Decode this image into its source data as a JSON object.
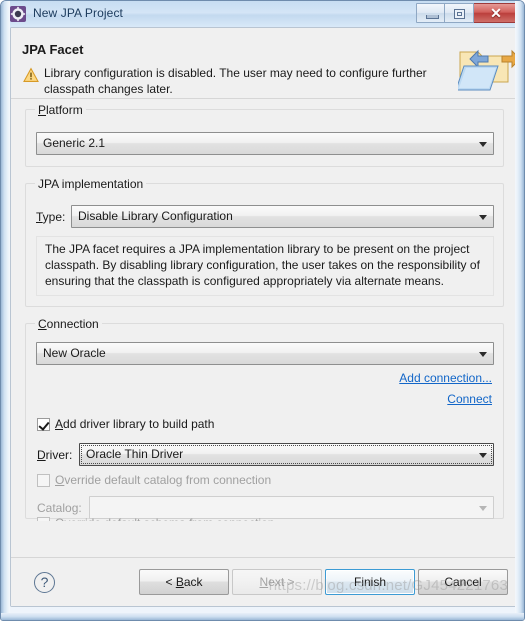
{
  "window": {
    "title": "New JPA Project",
    "icon": "jpa-project-icon",
    "caption_buttons": [
      {
        "name": "minimize",
        "glyph": "minimize-icon",
        "label": ""
      },
      {
        "name": "maximize",
        "glyph": "maximize-icon",
        "label": ""
      },
      {
        "name": "close",
        "glyph": "close-icon",
        "label": "✕"
      }
    ]
  },
  "header": {
    "title": "JPA Facet",
    "status_icon": "warning-icon",
    "status_text": "Library configuration is disabled. The user may need to configure further classpath changes later.",
    "banner_icon": "jpa-folder-arrows-icon"
  },
  "platform": {
    "group_label": "Platform",
    "group_mnemonic": "P",
    "selected": "Generic 2.1"
  },
  "jpa_implementation": {
    "group_label": "JPA implementation",
    "type_label": "Type:",
    "type_mnemonic": "T",
    "type_selected": "Disable Library Configuration",
    "description": "The JPA facet requires a JPA implementation library to be present on the project classpath. By disabling library configuration, the user takes on the responsibility of ensuring that the classpath is configured appropriately via alternate means."
  },
  "connection": {
    "group_label": "Connection",
    "group_mnemonic": "C",
    "selected": "New Oracle",
    "add_connection_link": "Add connection...",
    "connect_link": "Connect",
    "add_driver_checkbox": {
      "label": "Add driver library to build path",
      "mnemonic": "A",
      "checked": true,
      "enabled": true
    },
    "driver_label": "Driver:",
    "driver_mnemonic": "D",
    "driver_selected": "Oracle Thin Driver",
    "driver_focused": true,
    "override_catalog_checkbox": {
      "label": "Override default catalog from connection",
      "mnemonic": "O",
      "checked": false,
      "enabled": false
    },
    "catalog_label": "Catalog:",
    "catalog_mnemonic": "g",
    "catalog_selected": "",
    "catalog_enabled": false
  },
  "buttons": {
    "help": "?",
    "back": "< Back",
    "back_mnemonic": "B",
    "next": "Next >",
    "next_mnemonic": "N",
    "next_enabled": false,
    "finish": "Finish",
    "finish_default": true,
    "cancel": "Cancel"
  },
  "watermark": "https://blog.csdn.net/GJ454221763",
  "colors": {
    "link": "#1266c8",
    "dialog_bg": "#f0f0f0",
    "title_bg": "#cfe2f5",
    "default_button_border": "#3c9bd4",
    "close_button": "#bb3f3c",
    "warning_icon": "#f0ad26"
  }
}
